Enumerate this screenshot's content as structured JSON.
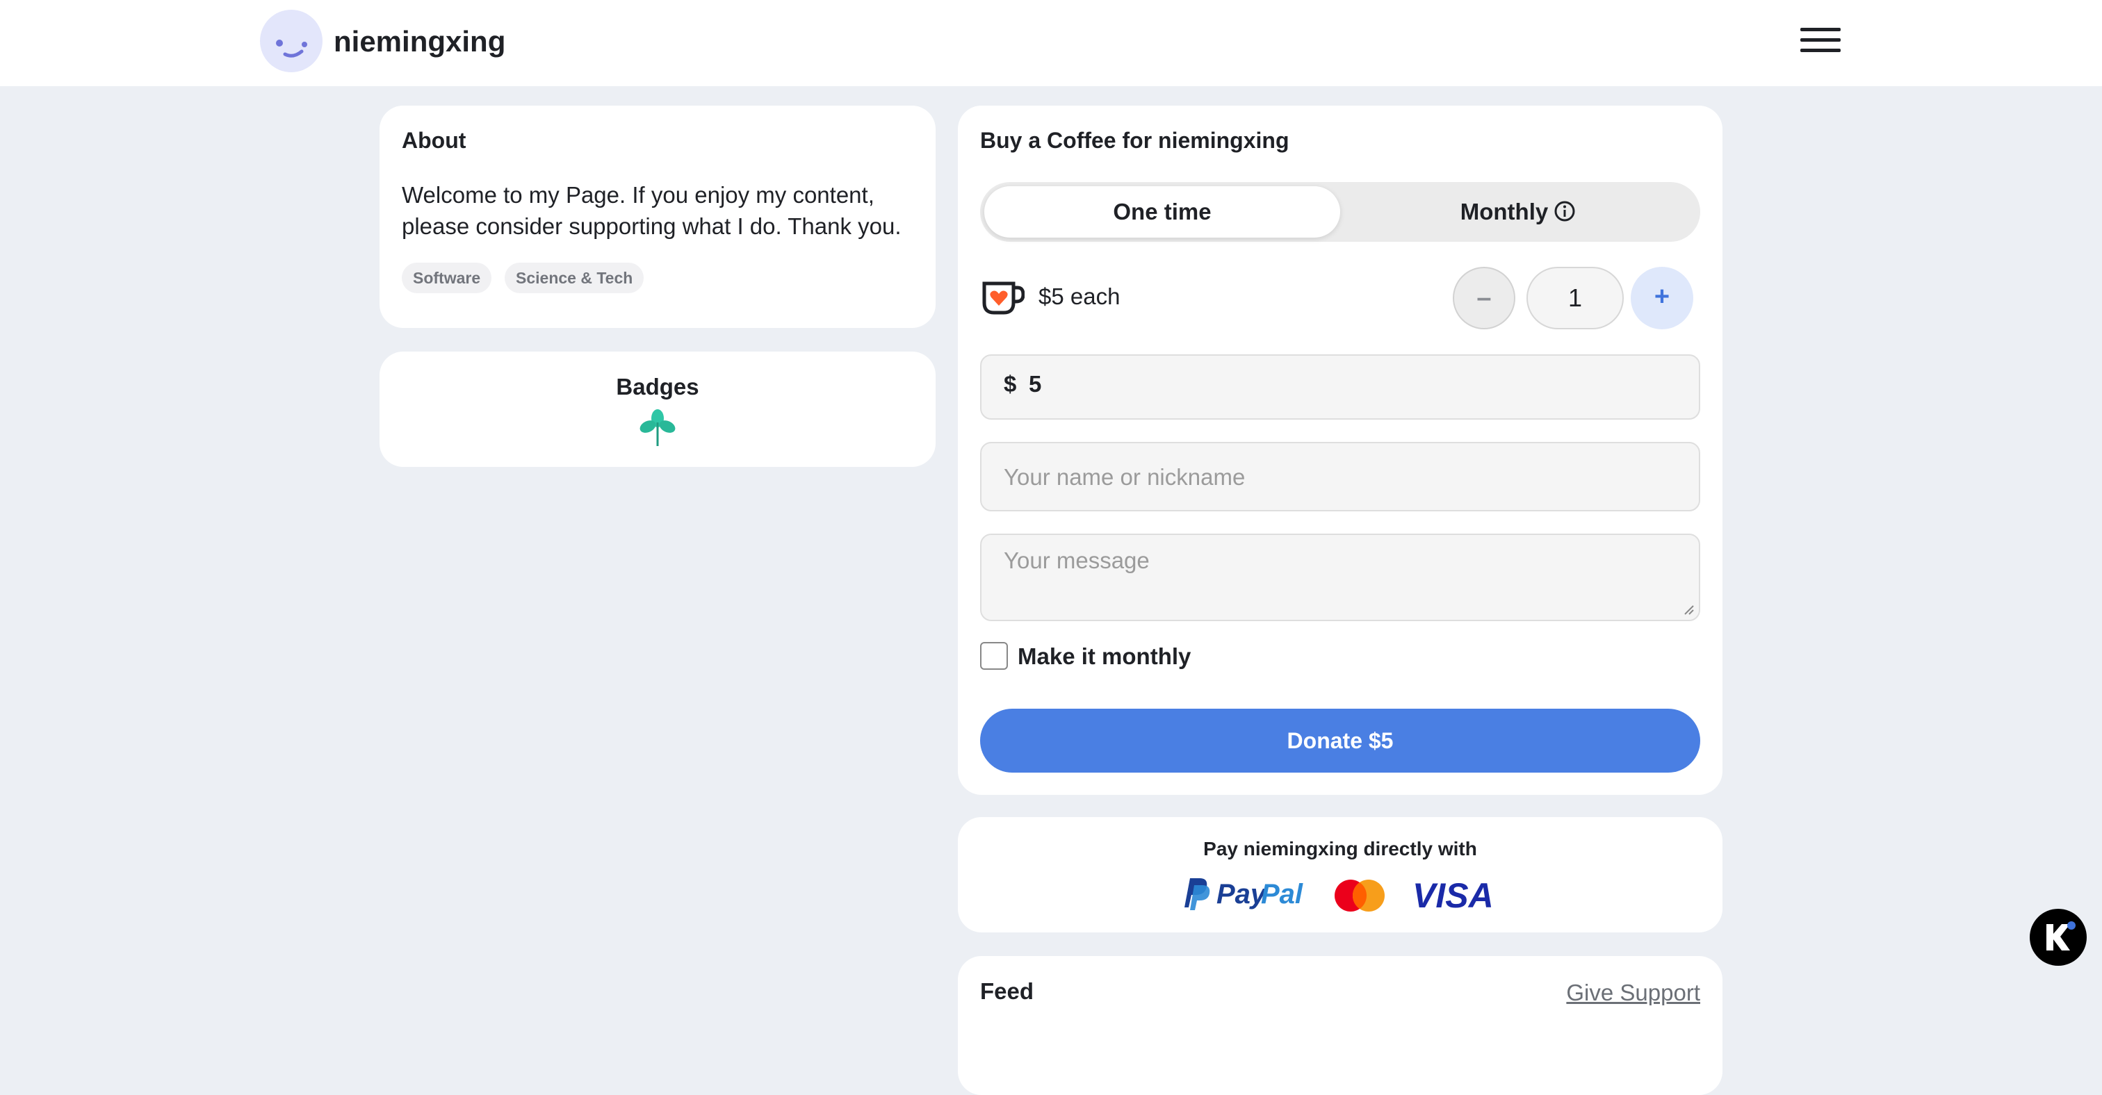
{
  "header": {
    "username": "niemingxing",
    "avatar_icon": "smiley-avatar-icon",
    "menu_icon": "hamburger-menu-icon"
  },
  "about": {
    "title": "About",
    "text": "Welcome to my Page. If you enjoy my content, please consider supporting what I do. Thank you.",
    "tags": [
      "Software",
      "Science & Tech"
    ]
  },
  "badges": {
    "title": "Badges",
    "icon": "leaf-badge-icon"
  },
  "donation": {
    "title": "Buy a Coffee for niemingxing",
    "tabs": {
      "one_time": "One time",
      "monthly": "Monthly",
      "active": "one_time"
    },
    "price_each": "$5 each",
    "quantity": "1",
    "minus_label": "–",
    "plus_label": "+",
    "currency": "$",
    "amount": "5",
    "name_placeholder": "Your name or nickname",
    "message_placeholder": "Your message",
    "monthly_checkbox_label": "Make it monthly",
    "monthly_checked": false,
    "donate_label": "Donate $5",
    "accent_color": "#4a7fe3"
  },
  "direct_pay": {
    "title": "Pay niemingxing directly with",
    "methods": [
      "PayPal",
      "Mastercard",
      "VISA"
    ]
  },
  "feed": {
    "title": "Feed",
    "link": "Give Support"
  },
  "fab": {
    "icon": "kofi-logo-icon"
  }
}
